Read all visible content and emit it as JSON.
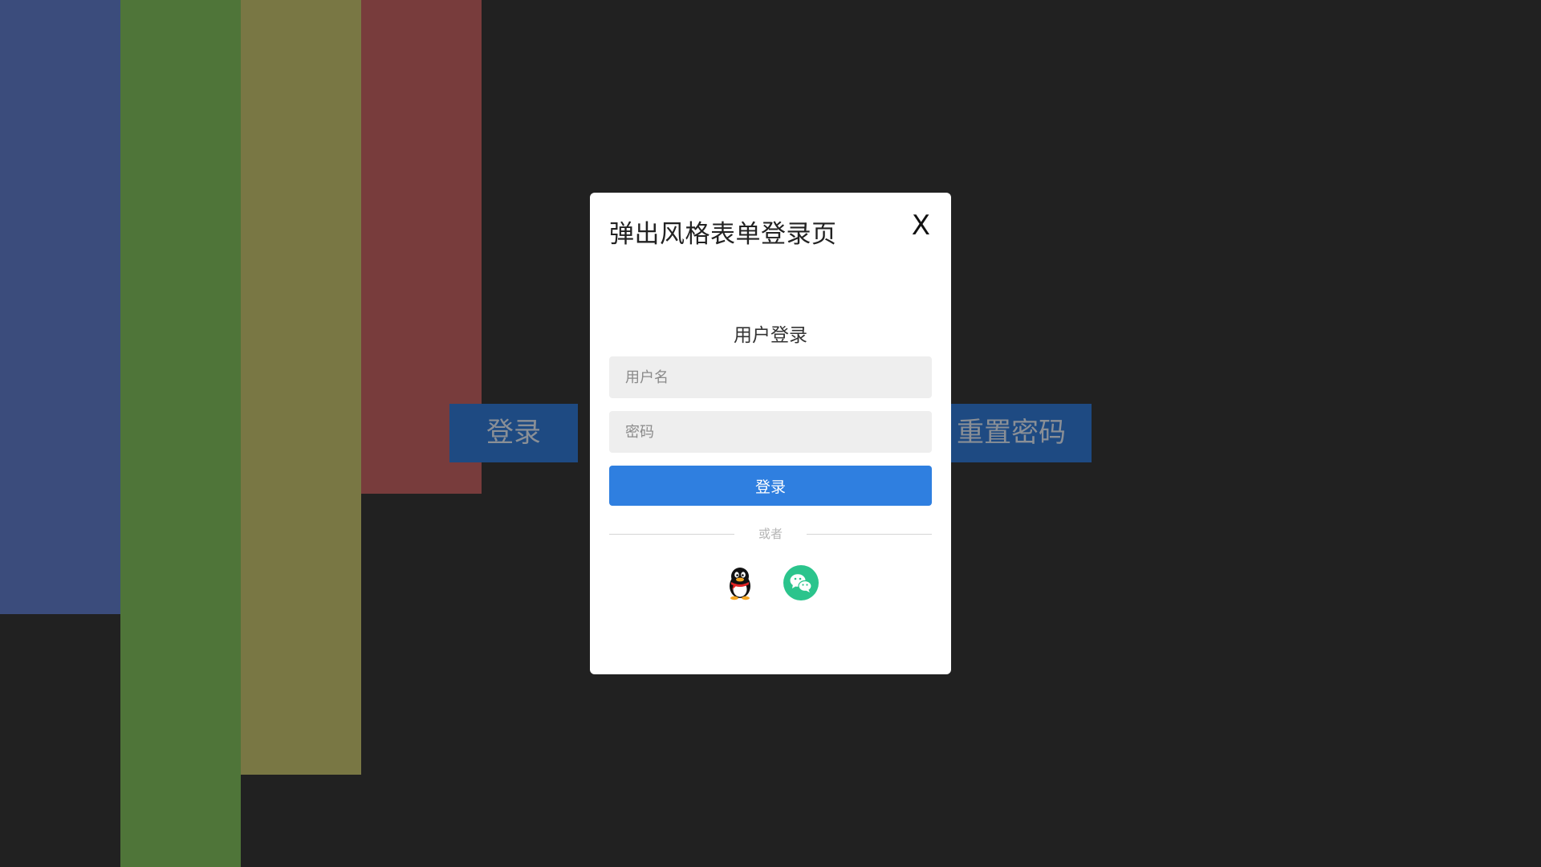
{
  "background": {
    "login_button": "登录",
    "reset_button": "重置密码",
    "colors": {
      "blue": "#3b4c7c",
      "green": "#4f7539",
      "olive": "#797744",
      "red": "#783c3c",
      "page": "#212121"
    }
  },
  "modal": {
    "title": "弹出风格表单登录页",
    "close_label": "X",
    "heading": "用户登录",
    "username_placeholder": "用户名",
    "password_placeholder": "密码",
    "submit_label": "登录",
    "divider_text": "或者",
    "social": {
      "qq_icon": "qq-icon",
      "wechat_icon": "wechat-icon"
    },
    "accent_color": "#2f7fe0"
  }
}
